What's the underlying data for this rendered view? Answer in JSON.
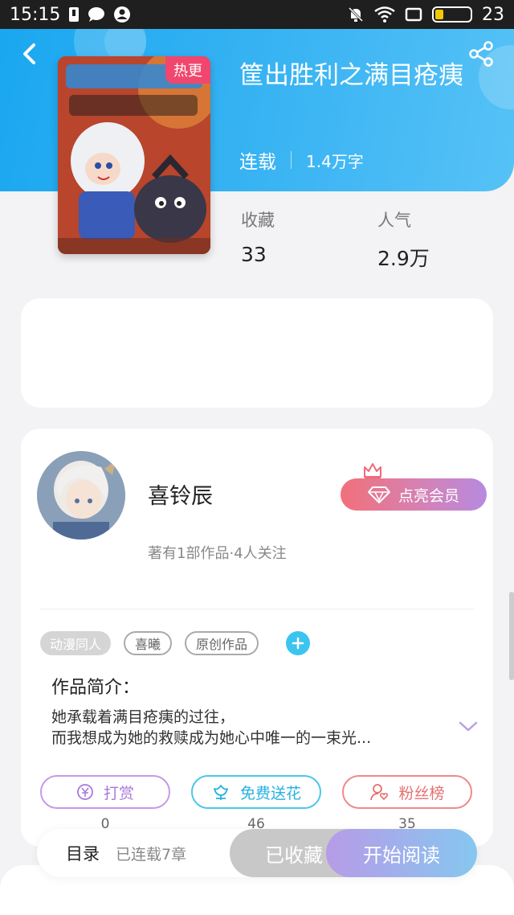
{
  "status_bar": {
    "time": "15:15",
    "battery": "23"
  },
  "book": {
    "badge": "热更",
    "title": "筐出胜利之满目疮痍",
    "status": "连载",
    "words": "1.4万字",
    "stats": [
      {
        "label": "收藏",
        "value": "33"
      },
      {
        "label": "人气",
        "value": "2.9万"
      }
    ]
  },
  "author": {
    "name": "喜铃辰",
    "subtitle": "著有1部作品·4人关注",
    "vip_label": "点亮会员"
  },
  "tags": [
    "动漫同人",
    "喜曦",
    "原创作品"
  ],
  "intro": {
    "title": "作品简介：",
    "line1": "她承载着满目疮痍的过往，",
    "line2": "而我想成为她的救赎成为她心中唯一的一束光..."
  },
  "actions": [
    {
      "label": "打赏",
      "count": "0"
    },
    {
      "label": "免费送花",
      "count": "46"
    },
    {
      "label": "粉丝榜",
      "count": "35"
    }
  ],
  "bottom_bar": {
    "catalog": "目录",
    "chapters": "已连载7章",
    "collected": "已收藏",
    "read": "开始阅读"
  },
  "colors": {
    "header": "#1aa7f0",
    "badge": "#f1466d",
    "tag_add": "#3cc4f0"
  },
  "icons": [
    "back-arrow-icon",
    "share-icon",
    "crown-icon",
    "diamond-icon",
    "coin-icon",
    "flower-icon",
    "user-heart-icon",
    "chevron-down-icon",
    "plus-icon"
  ]
}
